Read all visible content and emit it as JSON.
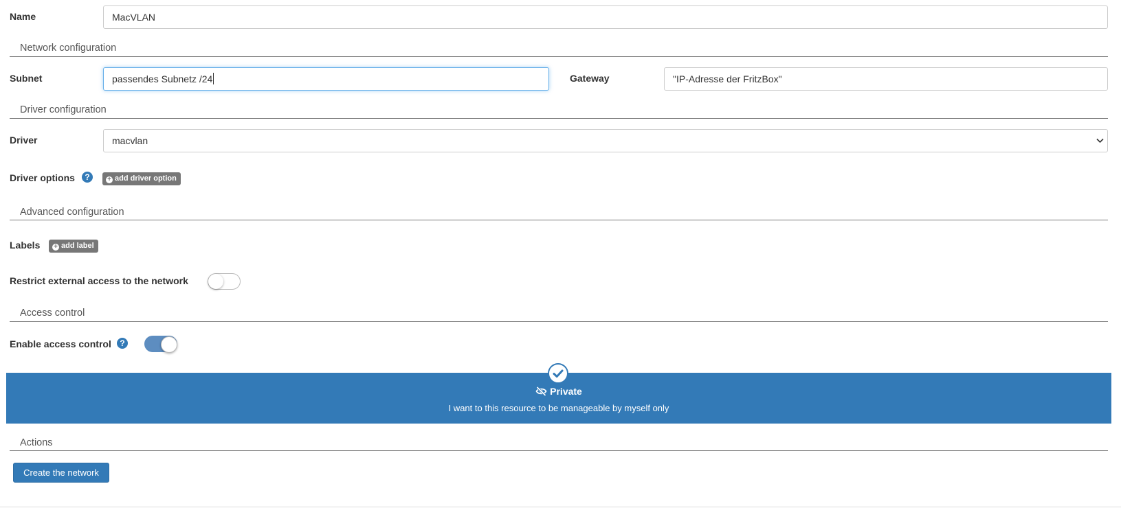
{
  "name": {
    "label": "Name",
    "value": "MacVLAN"
  },
  "network_config": {
    "title": "Network configuration",
    "subnet": {
      "label": "Subnet",
      "value": "passendes Subnetz /24"
    },
    "gateway": {
      "label": "Gateway",
      "value": "\"IP-Adresse der FritzBox\""
    }
  },
  "driver_config": {
    "title": "Driver configuration",
    "driver": {
      "label": "Driver",
      "value": "macvlan"
    },
    "driver_options": {
      "label": "Driver options",
      "button": "add driver option"
    }
  },
  "advanced_config": {
    "title": "Advanced configuration",
    "labels": {
      "label": "Labels",
      "button": "add label"
    },
    "restrict": {
      "label": "Restrict external access to the network",
      "enabled": false
    }
  },
  "access_control": {
    "title": "Access control",
    "enable": {
      "label": "Enable access control",
      "enabled": true
    },
    "private": {
      "title": "Private",
      "description": "I want to this resource to be manageable by myself only"
    }
  },
  "actions": {
    "title": "Actions",
    "create_button": "Create the network"
  },
  "colors": {
    "primary": "#337ab7",
    "muted_button": "#777777",
    "focus": "#66afe9"
  },
  "icons": [
    "question-icon",
    "plus-circle-icon",
    "check-icon",
    "eye-slash-icon",
    "chevron-down-icon"
  ]
}
